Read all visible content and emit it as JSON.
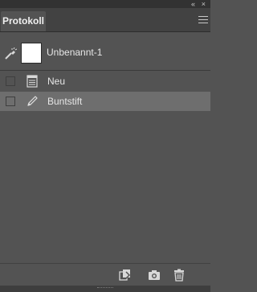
{
  "panel": {
    "tab_label": "Protokoll",
    "collapse_glyph": "«",
    "close_glyph": "×",
    "menu_icon": "panel-menu-icon"
  },
  "snapshot": {
    "label": "Unbenannt-1",
    "source_icon": "history-brush-source-icon",
    "thumbnail_color": "#ffffff"
  },
  "history": [
    {
      "label": "Neu",
      "icon": "new-document-icon",
      "selected": false
    },
    {
      "label": "Buntstift",
      "icon": "pencil-icon",
      "selected": true
    }
  ],
  "footer": {
    "new_document_from_state": "new-document-from-state-icon",
    "new_snapshot": "camera-icon",
    "delete": "trash-icon"
  },
  "colors": {
    "panel_bg": "#535353",
    "selected_row": "#6e6e6e",
    "tab_bar": "#424242"
  }
}
